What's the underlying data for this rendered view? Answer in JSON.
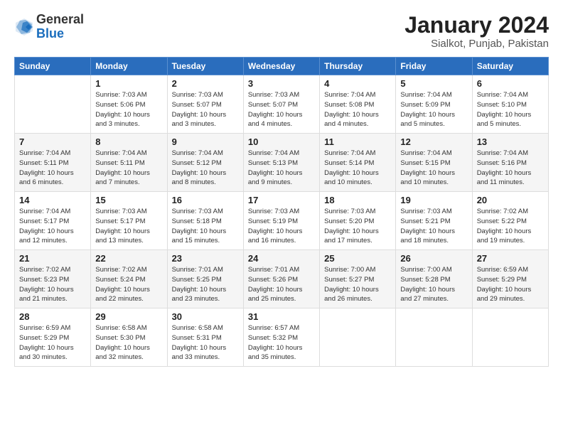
{
  "logo": {
    "general": "General",
    "blue": "Blue"
  },
  "title": "January 2024",
  "subtitle": "Sialkot, Punjab, Pakistan",
  "days_header": [
    "Sunday",
    "Monday",
    "Tuesday",
    "Wednesday",
    "Thursday",
    "Friday",
    "Saturday"
  ],
  "weeks": [
    [
      {
        "num": "",
        "info": ""
      },
      {
        "num": "1",
        "info": "Sunrise: 7:03 AM\nSunset: 5:06 PM\nDaylight: 10 hours\nand 3 minutes."
      },
      {
        "num": "2",
        "info": "Sunrise: 7:03 AM\nSunset: 5:07 PM\nDaylight: 10 hours\nand 3 minutes."
      },
      {
        "num": "3",
        "info": "Sunrise: 7:03 AM\nSunset: 5:07 PM\nDaylight: 10 hours\nand 4 minutes."
      },
      {
        "num": "4",
        "info": "Sunrise: 7:04 AM\nSunset: 5:08 PM\nDaylight: 10 hours\nand 4 minutes."
      },
      {
        "num": "5",
        "info": "Sunrise: 7:04 AM\nSunset: 5:09 PM\nDaylight: 10 hours\nand 5 minutes."
      },
      {
        "num": "6",
        "info": "Sunrise: 7:04 AM\nSunset: 5:10 PM\nDaylight: 10 hours\nand 5 minutes."
      }
    ],
    [
      {
        "num": "7",
        "info": "Sunrise: 7:04 AM\nSunset: 5:11 PM\nDaylight: 10 hours\nand 6 minutes."
      },
      {
        "num": "8",
        "info": "Sunrise: 7:04 AM\nSunset: 5:11 PM\nDaylight: 10 hours\nand 7 minutes."
      },
      {
        "num": "9",
        "info": "Sunrise: 7:04 AM\nSunset: 5:12 PM\nDaylight: 10 hours\nand 8 minutes."
      },
      {
        "num": "10",
        "info": "Sunrise: 7:04 AM\nSunset: 5:13 PM\nDaylight: 10 hours\nand 9 minutes."
      },
      {
        "num": "11",
        "info": "Sunrise: 7:04 AM\nSunset: 5:14 PM\nDaylight: 10 hours\nand 10 minutes."
      },
      {
        "num": "12",
        "info": "Sunrise: 7:04 AM\nSunset: 5:15 PM\nDaylight: 10 hours\nand 10 minutes."
      },
      {
        "num": "13",
        "info": "Sunrise: 7:04 AM\nSunset: 5:16 PM\nDaylight: 10 hours\nand 11 minutes."
      }
    ],
    [
      {
        "num": "14",
        "info": "Sunrise: 7:04 AM\nSunset: 5:17 PM\nDaylight: 10 hours\nand 12 minutes."
      },
      {
        "num": "15",
        "info": "Sunrise: 7:03 AM\nSunset: 5:17 PM\nDaylight: 10 hours\nand 13 minutes."
      },
      {
        "num": "16",
        "info": "Sunrise: 7:03 AM\nSunset: 5:18 PM\nDaylight: 10 hours\nand 15 minutes."
      },
      {
        "num": "17",
        "info": "Sunrise: 7:03 AM\nSunset: 5:19 PM\nDaylight: 10 hours\nand 16 minutes."
      },
      {
        "num": "18",
        "info": "Sunrise: 7:03 AM\nSunset: 5:20 PM\nDaylight: 10 hours\nand 17 minutes."
      },
      {
        "num": "19",
        "info": "Sunrise: 7:03 AM\nSunset: 5:21 PM\nDaylight: 10 hours\nand 18 minutes."
      },
      {
        "num": "20",
        "info": "Sunrise: 7:02 AM\nSunset: 5:22 PM\nDaylight: 10 hours\nand 19 minutes."
      }
    ],
    [
      {
        "num": "21",
        "info": "Sunrise: 7:02 AM\nSunset: 5:23 PM\nDaylight: 10 hours\nand 21 minutes."
      },
      {
        "num": "22",
        "info": "Sunrise: 7:02 AM\nSunset: 5:24 PM\nDaylight: 10 hours\nand 22 minutes."
      },
      {
        "num": "23",
        "info": "Sunrise: 7:01 AM\nSunset: 5:25 PM\nDaylight: 10 hours\nand 23 minutes."
      },
      {
        "num": "24",
        "info": "Sunrise: 7:01 AM\nSunset: 5:26 PM\nDaylight: 10 hours\nand 25 minutes."
      },
      {
        "num": "25",
        "info": "Sunrise: 7:00 AM\nSunset: 5:27 PM\nDaylight: 10 hours\nand 26 minutes."
      },
      {
        "num": "26",
        "info": "Sunrise: 7:00 AM\nSunset: 5:28 PM\nDaylight: 10 hours\nand 27 minutes."
      },
      {
        "num": "27",
        "info": "Sunrise: 6:59 AM\nSunset: 5:29 PM\nDaylight: 10 hours\nand 29 minutes."
      }
    ],
    [
      {
        "num": "28",
        "info": "Sunrise: 6:59 AM\nSunset: 5:29 PM\nDaylight: 10 hours\nand 30 minutes."
      },
      {
        "num": "29",
        "info": "Sunrise: 6:58 AM\nSunset: 5:30 PM\nDaylight: 10 hours\nand 32 minutes."
      },
      {
        "num": "30",
        "info": "Sunrise: 6:58 AM\nSunset: 5:31 PM\nDaylight: 10 hours\nand 33 minutes."
      },
      {
        "num": "31",
        "info": "Sunrise: 6:57 AM\nSunset: 5:32 PM\nDaylight: 10 hours\nand 35 minutes."
      },
      {
        "num": "",
        "info": ""
      },
      {
        "num": "",
        "info": ""
      },
      {
        "num": "",
        "info": ""
      }
    ]
  ]
}
